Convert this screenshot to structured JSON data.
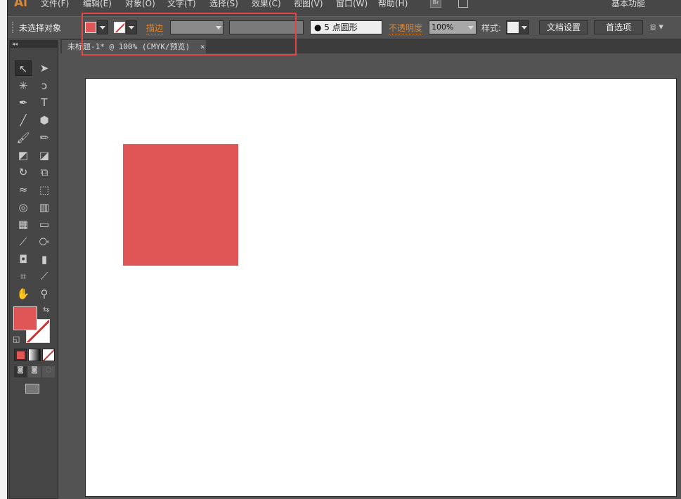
{
  "app": {
    "logo": "Ai"
  },
  "menu": [
    "文件(F)",
    "编辑(E)",
    "对象(O)",
    "文字(T)",
    "选择(S)",
    "效果(C)",
    "视图(V)",
    "窗口(W)",
    "帮助(H)"
  ],
  "menu_extras": {
    "bridge": "Br",
    "workspace": "基本功能"
  },
  "control": {
    "selection_status": "未选择对象",
    "fill_color": "#e05555",
    "stroke_label": "描边",
    "brush_value": "5 点圆形",
    "opacity_label": "不透明度",
    "opacity_value": "100%",
    "style_label": "样式:",
    "doc_setup": "文档设置",
    "preferences": "首选项"
  },
  "document": {
    "tab_title": "未标题-1* @ 100% (CMYK/预览)",
    "close": "×"
  },
  "artwork": {
    "rect_color": "#e05555"
  },
  "tools": [
    [
      "selection-tool",
      "↖"
    ],
    [
      "direct-selection-tool",
      "➤"
    ],
    [
      "magic-wand-tool",
      "✳"
    ],
    [
      "lasso-tool",
      "ↄ"
    ],
    [
      "pen-tool",
      "✒"
    ],
    [
      "type-tool",
      "T"
    ],
    [
      "line-tool",
      "╱"
    ],
    [
      "shape-tool",
      "⬢"
    ],
    [
      "paintbrush-tool",
      "🖌"
    ],
    [
      "pencil-tool",
      "✏"
    ],
    [
      "blob-brush-tool",
      "◩"
    ],
    [
      "eraser-tool",
      "◪"
    ],
    [
      "rotate-tool",
      "↻"
    ],
    [
      "scale-tool",
      "⧉"
    ],
    [
      "warp-tool",
      "≈"
    ],
    [
      "free-transform-tool",
      "⬚"
    ],
    [
      "shape-builder-tool",
      "◎"
    ],
    [
      "graph-tool",
      "▥"
    ],
    [
      "mesh-tool",
      "▦"
    ],
    [
      "gradient-tool",
      "▭"
    ],
    [
      "eyedropper-tool",
      "⟋"
    ],
    [
      "blend-tool",
      "⧂"
    ],
    [
      "symbol-sprayer-tool",
      "◘"
    ],
    [
      "column-graph-tool",
      "▮"
    ],
    [
      "artboard-tool",
      "⌗"
    ],
    [
      "slice-tool",
      "⟋"
    ],
    [
      "hand-tool",
      "✋"
    ],
    [
      "zoom-tool",
      "⚲"
    ]
  ]
}
